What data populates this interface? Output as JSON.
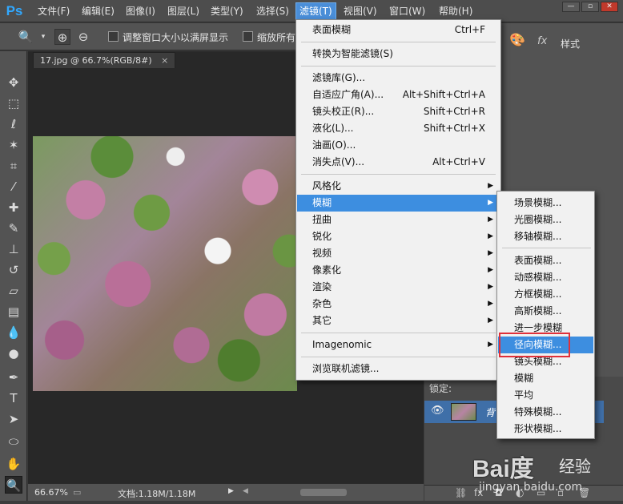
{
  "app": {
    "logo": "Ps"
  },
  "menubar": {
    "items": [
      "文件(F)",
      "编辑(E)",
      "图像(I)",
      "图层(L)",
      "类型(Y)",
      "选择(S)",
      "滤镜(T)",
      "视图(V)",
      "窗口(W)",
      "帮助(H)"
    ],
    "active": "滤镜(T)",
    "window_controls": {
      "minimize": "—",
      "restore": "▫",
      "close": "✕"
    }
  },
  "options": {
    "fit_window_label": "调整窗口大小以满屏显示",
    "zoom_all_label": "缩放所有"
  },
  "document": {
    "tab_title": "17.jpg @ 66.7%(RGB/8#)",
    "tab_close": "×"
  },
  "status": {
    "zoom": "66.67%",
    "doc_size": "文档:1.18M/1.18M"
  },
  "panels": {
    "style_label": "样式",
    "fx_label": "fx",
    "lock_label": "锁定:",
    "layer_name": "背"
  },
  "filter_menu": {
    "last_filter": {
      "label": "表面模糊",
      "shortcut": "Ctrl+F"
    },
    "smart_filters": "转换为智能滤镜(S)",
    "gallery": "滤镜库(G)...",
    "adaptive_wide": {
      "label": "自适应广角(A)...",
      "shortcut": "Alt+Shift+Ctrl+A"
    },
    "lens_correction": {
      "label": "镜头校正(R)...",
      "shortcut": "Shift+Ctrl+R"
    },
    "liquify": {
      "label": "液化(L)...",
      "shortcut": "Shift+Ctrl+X"
    },
    "oil_paint": "油画(O)...",
    "vanishing_point": {
      "label": "消失点(V)...",
      "shortcut": "Alt+Ctrl+V"
    },
    "groups": [
      "风格化",
      "模糊",
      "扭曲",
      "锐化",
      "视频",
      "像素化",
      "渲染",
      "杂色",
      "其它"
    ],
    "highlighted_group": "模糊",
    "plugin": "Imagenomic",
    "browse_online": "浏览联机滤镜..."
  },
  "blur_menu": {
    "gallery_items": [
      "场景模糊...",
      "光圈模糊...",
      "移轴模糊..."
    ],
    "items": [
      "表面模糊...",
      "动感模糊...",
      "方框模糊...",
      "高斯模糊...",
      "进一步模糊",
      "径向模糊...",
      "镜头模糊...",
      "模糊",
      "平均",
      "特殊模糊...",
      "形状模糊..."
    ],
    "highlighted": "径向模糊..."
  },
  "watermark": {
    "logo": "Bai度",
    "cn": "经验",
    "url": "jingyan.baidu.com"
  },
  "colors": {
    "menu_highlight": "#3d8ee0",
    "callout_red": "#e0303a",
    "ps_blue": "#31a8ff"
  }
}
